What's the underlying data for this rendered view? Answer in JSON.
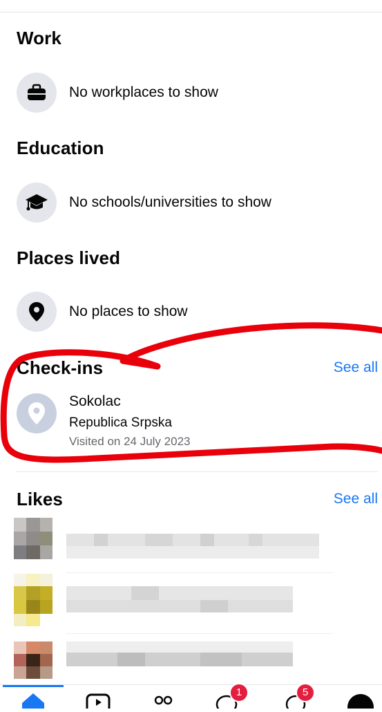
{
  "work": {
    "title": "Work",
    "empty": "No workplaces to show",
    "icon": "briefcase-icon"
  },
  "education": {
    "title": "Education",
    "empty": "No schools/universities to show",
    "icon": "graduation-cap-icon"
  },
  "places": {
    "title": "Places lived",
    "empty": "No places to show",
    "icon": "location-pin-icon"
  },
  "checkins": {
    "title": "Check-ins",
    "see_all": "See all",
    "item": {
      "name": "Sokolac",
      "region": "Republica Srpska",
      "visited": "Visited on 24 July 2023",
      "icon": "location-pin-icon"
    }
  },
  "likes": {
    "title": "Likes",
    "see_all": "See all"
  },
  "tabbar": {
    "tabs": [
      "home-icon",
      "video-icon",
      "friends-icon",
      "messages-icon",
      "notifications-icon",
      "profile-avatar"
    ],
    "messages_badge": "1",
    "notifications_badge": "5"
  },
  "colors": {
    "accent": "#1877f2",
    "badge": "#e41e3f",
    "annotation": "#e8000b"
  }
}
